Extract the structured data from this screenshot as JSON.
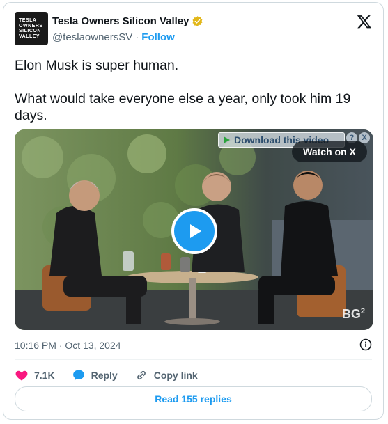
{
  "author": {
    "avatar_lines": [
      "TESLA",
      "OWNERS",
      "SILICON",
      "VALLEY"
    ],
    "name": "Tesla Owners Silicon Valley",
    "handle": "@teslaownersSV",
    "separator": "·",
    "follow_label": "Follow",
    "verified_color": "#e2b719"
  },
  "tweet": {
    "paragraph1": "Elon Musk is super human.",
    "paragraph2": "What would take everyone else a year, only took him 19 days."
  },
  "media": {
    "download_label": "Download this video",
    "mini_help": "?",
    "mini_close": "X",
    "watch_label": "Watch on X",
    "watermark": "BG",
    "watermark_sup": "2"
  },
  "meta": {
    "timestamp": "10:16 PM · Oct 13, 2024"
  },
  "actions": {
    "likes": "7.1K",
    "reply_label": "Reply",
    "copy_label": "Copy link"
  },
  "read_replies_label": "Read 155 replies",
  "colors": {
    "accent": "#1d9bf0",
    "like": "#f91880",
    "text": "#0f1419",
    "muted": "#536471"
  }
}
